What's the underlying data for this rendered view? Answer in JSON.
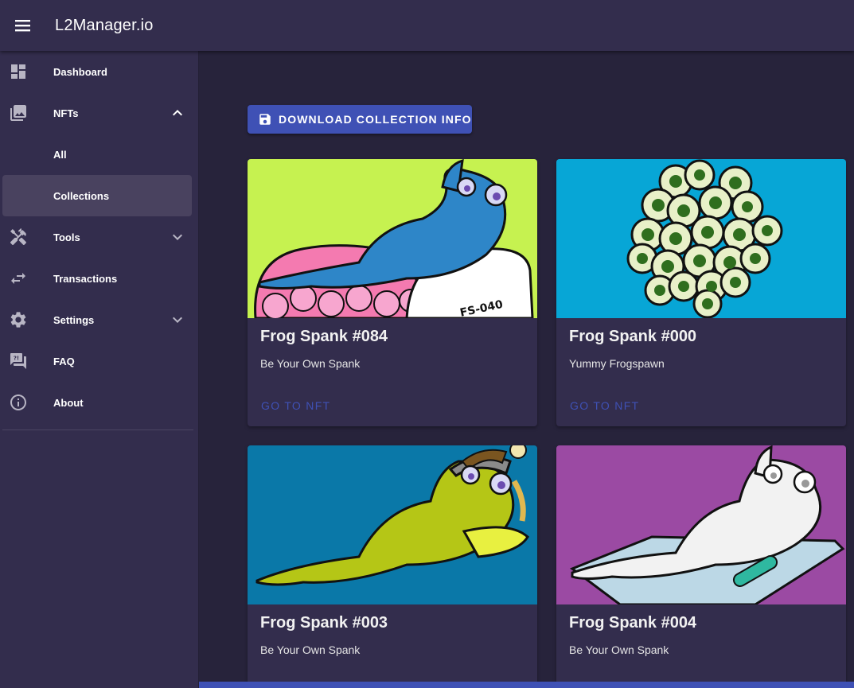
{
  "app": {
    "title": "L2Manager.io"
  },
  "sidebar": {
    "items": [
      {
        "label": "Dashboard"
      },
      {
        "label": "NFTs"
      },
      {
        "label": "All"
      },
      {
        "label": "Collections"
      },
      {
        "label": "Tools"
      },
      {
        "label": "Transactions"
      },
      {
        "label": "Settings"
      },
      {
        "label": "FAQ"
      },
      {
        "label": "About"
      }
    ]
  },
  "main": {
    "download_label": "DOWNLOAD COLLECTION INFO",
    "cards": [
      {
        "title": "Frog Spank #084",
        "subtitle": "Be Your Own Spank",
        "action": "GO TO NFT",
        "art_text": "FS-040",
        "bg": "#c6f250"
      },
      {
        "title": "Frog Spank #000",
        "subtitle": "Yummy Frogspawn",
        "action": "GO TO NFT",
        "bg": "#07a6d6"
      },
      {
        "title": "Frog Spank #003",
        "subtitle": "Be Your Own Spank",
        "bg": "#0a78a8"
      },
      {
        "title": "Frog Spank #004",
        "subtitle": "Be Your Own Spank",
        "bg": "#9b4aa3"
      }
    ]
  },
  "colors": {
    "accent": "#3f51b5",
    "surface": "#332d4d",
    "background": "#27233b"
  }
}
